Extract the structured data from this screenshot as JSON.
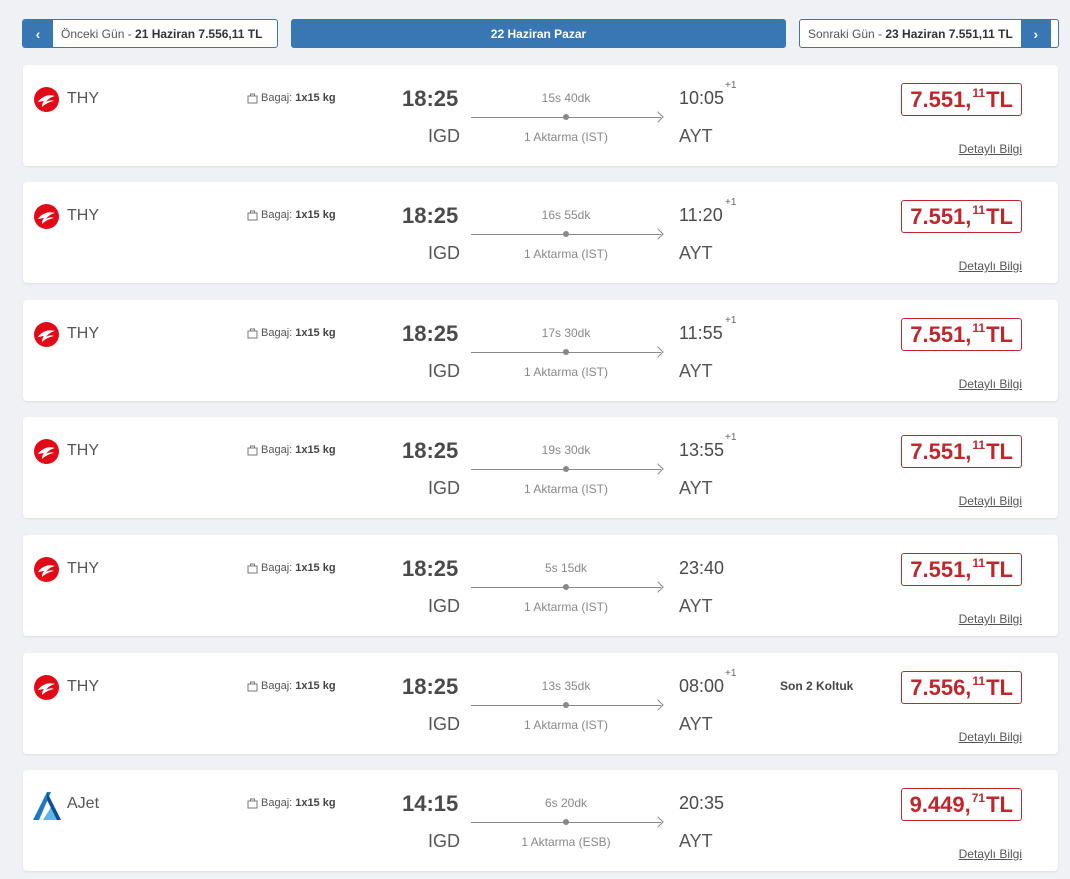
{
  "nav": {
    "prev_label": "Önceki Gün - ",
    "prev_date": "21 Haziran 7.556,11 TL",
    "current": "22 Haziran Pazar",
    "next_label": "Sonraki Gün - ",
    "next_date": "23 Haziran 7.551,11 TL"
  },
  "colors": {
    "accent": "#3877b3",
    "price": "#c0272d",
    "thy": "#e30a17",
    "ajet": "#1f78c1"
  },
  "flights": [
    {
      "airline": "THY",
      "logo": "thy-logo-icon",
      "baggage_label": "Bagaj:",
      "baggage": "1x15 kg",
      "dep_time": "18:25",
      "dep_code": "IGD",
      "duration": "15s 40dk",
      "transfer": "1 Aktarma (IST)",
      "arr_time": "10:05",
      "plus": "+1",
      "arr_code": "AYT",
      "seats": "",
      "price_main": "7.551,",
      "price_cents": "11",
      "currency": "TL",
      "detail": "Detaylı Bilgi"
    },
    {
      "airline": "THY",
      "logo": "thy-logo-icon",
      "baggage_label": "Bagaj:",
      "baggage": "1x15 kg",
      "dep_time": "18:25",
      "dep_code": "IGD",
      "duration": "16s 55dk",
      "transfer": "1 Aktarma (IST)",
      "arr_time": "11:20",
      "plus": "+1",
      "arr_code": "AYT",
      "seats": "",
      "price_main": "7.551,",
      "price_cents": "11",
      "currency": "TL",
      "detail": "Detaylı Bilgi"
    },
    {
      "airline": "THY",
      "logo": "thy-logo-icon",
      "baggage_label": "Bagaj:",
      "baggage": "1x15 kg",
      "dep_time": "18:25",
      "dep_code": "IGD",
      "duration": "17s 30dk",
      "transfer": "1 Aktarma (IST)",
      "arr_time": "11:55",
      "plus": "+1",
      "arr_code": "AYT",
      "seats": "",
      "price_main": "7.551,",
      "price_cents": "11",
      "currency": "TL",
      "detail": "Detaylı Bilgi"
    },
    {
      "airline": "THY",
      "logo": "thy-logo-icon",
      "baggage_label": "Bagaj:",
      "baggage": "1x15 kg",
      "dep_time": "18:25",
      "dep_code": "IGD",
      "duration": "19s 30dk",
      "transfer": "1 Aktarma (IST)",
      "arr_time": "13:55",
      "plus": "+1",
      "arr_code": "AYT",
      "seats": "",
      "price_main": "7.551,",
      "price_cents": "11",
      "currency": "TL",
      "detail": "Detaylı Bilgi"
    },
    {
      "airline": "THY",
      "logo": "thy-logo-icon",
      "baggage_label": "Bagaj:",
      "baggage": "1x15 kg",
      "dep_time": "18:25",
      "dep_code": "IGD",
      "duration": "5s 15dk",
      "transfer": "1 Aktarma (IST)",
      "arr_time": "23:40",
      "plus": "",
      "arr_code": "AYT",
      "seats": "",
      "price_main": "7.551,",
      "price_cents": "11",
      "currency": "TL",
      "detail": "Detaylı Bilgi"
    },
    {
      "airline": "THY",
      "logo": "thy-logo-icon",
      "baggage_label": "Bagaj:",
      "baggage": "1x15 kg",
      "dep_time": "18:25",
      "dep_code": "IGD",
      "duration": "13s 35dk",
      "transfer": "1 Aktarma (IST)",
      "arr_time": "08:00",
      "plus": "+1",
      "arr_code": "AYT",
      "seats": "Son 2 Koltuk",
      "price_main": "7.556,",
      "price_cents": "11",
      "currency": "TL",
      "detail": "Detaylı Bilgi"
    },
    {
      "airline": "AJet",
      "logo": "ajet-logo-icon",
      "baggage_label": "Bagaj:",
      "baggage": "1x15 kg",
      "dep_time": "14:15",
      "dep_code": "IGD",
      "duration": "6s 20dk",
      "transfer": "1 Aktarma (ESB)",
      "arr_time": "20:35",
      "plus": "",
      "arr_code": "AYT",
      "seats": "",
      "price_main": "9.449,",
      "price_cents": "71",
      "currency": "TL",
      "detail": "Detaylı Bilgi"
    }
  ]
}
